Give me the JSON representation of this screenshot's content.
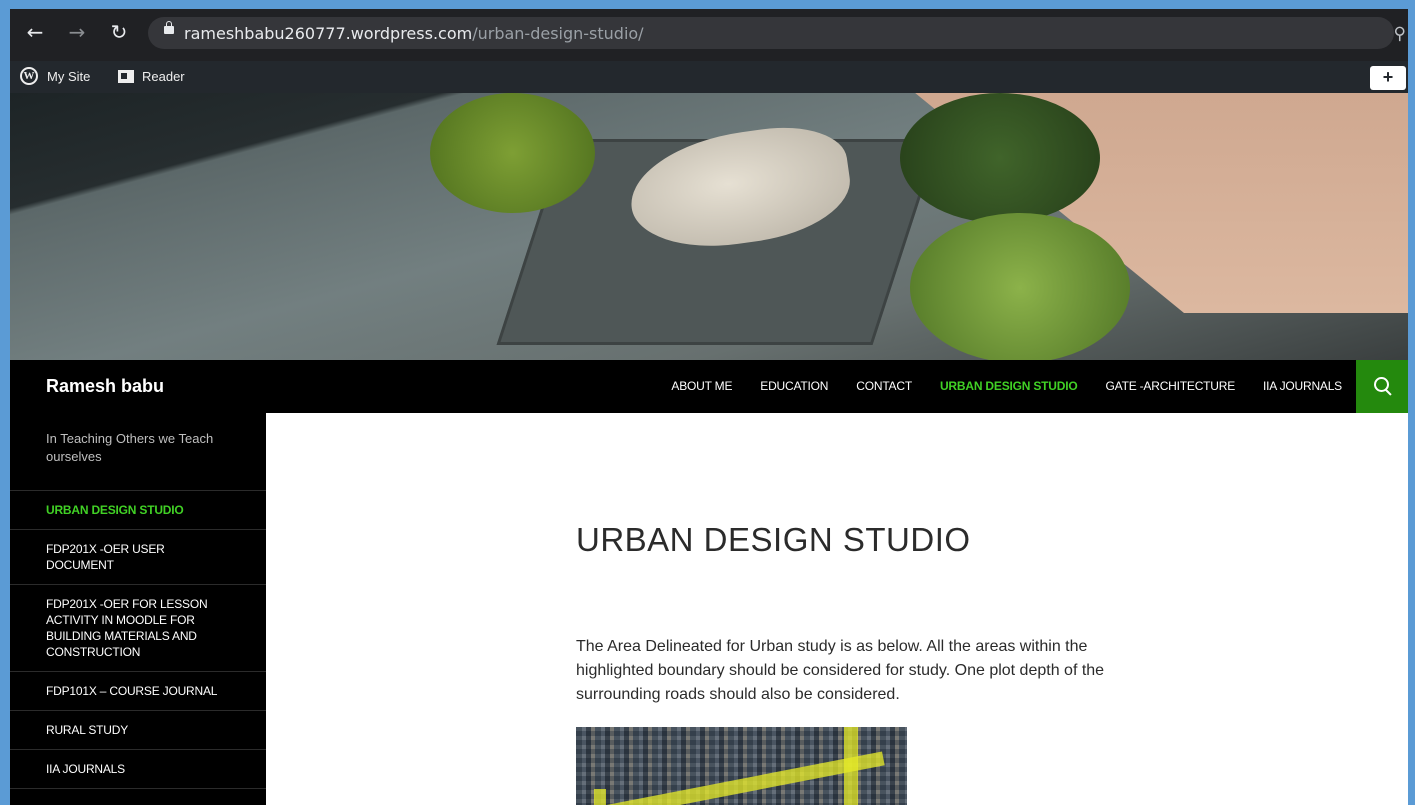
{
  "browser": {
    "url_domain": "rameshbabu260777.wordpress.com",
    "url_path": "/urban-design-studio/"
  },
  "adminbar": {
    "my_site": "My Site",
    "reader": "Reader"
  },
  "site": {
    "title": "Ramesh babu",
    "tagline": "In Teaching Others we Teach ourselves"
  },
  "menu": [
    {
      "label": "ABOUT ME"
    },
    {
      "label": "EDUCATION"
    },
    {
      "label": "CONTACT"
    },
    {
      "label": "URBAN DESIGN STUDIO",
      "current": true
    },
    {
      "label": "GATE -ARCHITECTURE"
    },
    {
      "label": "IIA JOURNALS"
    }
  ],
  "sidebar": [
    {
      "label": "URBAN DESIGN STUDIO",
      "current": true
    },
    {
      "label": "FDP201X -OER USER DOCUMENT"
    },
    {
      "label": "FDP201X -OER FOR LESSON ACTIVITY IN MOODLE FOR BUILDING MATERIALS AND CONSTRUCTION"
    },
    {
      "label": "FDP101X – COURSE JOURNAL"
    },
    {
      "label": "RURAL STUDY"
    },
    {
      "label": "IIA JOURNALS"
    }
  ],
  "content": {
    "title": "URBAN DESIGN STUDIO",
    "body": "The Area Delineated for Urban study is as below. All the areas within the highlighted boundary should be considered for study. One plot depth of the surrounding roads should also be considered."
  },
  "colors": {
    "accent_green": "#41d125",
    "search_green": "#24890d"
  }
}
